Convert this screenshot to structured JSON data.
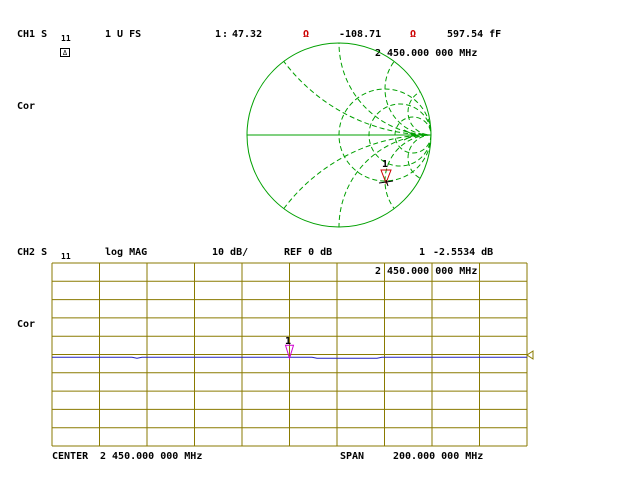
{
  "ch1": {
    "label": "CH1 S",
    "param_sub": "11",
    "scale": "1 U FS",
    "marker_num": "1",
    "marker_resistance": "47.32",
    "ohm1": "Ω",
    "marker_reactance": "-108.71",
    "ohm2": "Ω",
    "marker_value3": "597.54 fF",
    "marker_freq": "2 450.000 000 MHz",
    "badge": "Δ",
    "cor": "Cor",
    "trace_marker_label": "1"
  },
  "ch2": {
    "label": "CH2 S",
    "param_sub": "11",
    "format": "log MAG",
    "scale": "10 dB/",
    "ref": "REF 0 dB",
    "marker_num": "1",
    "marker_value": "-2.5534 dB",
    "marker_freq": "2 450.000 000 MHz",
    "cor": "Cor",
    "trace_marker_label": "1",
    "center_label": "CENTER",
    "center_value": "2 450.000 000 MHz",
    "span_label": "SPAN",
    "span_value": "200.000 000 MHz",
    "ref_level_db": 0,
    "db_per_div": 10,
    "trace_db": -2.55
  },
  "colors": {
    "smith": "#00a000",
    "grid": "#8a7a00",
    "trace": "#2020c0",
    "marker": "#d000d0",
    "smith_marker": "#cc0000"
  }
}
